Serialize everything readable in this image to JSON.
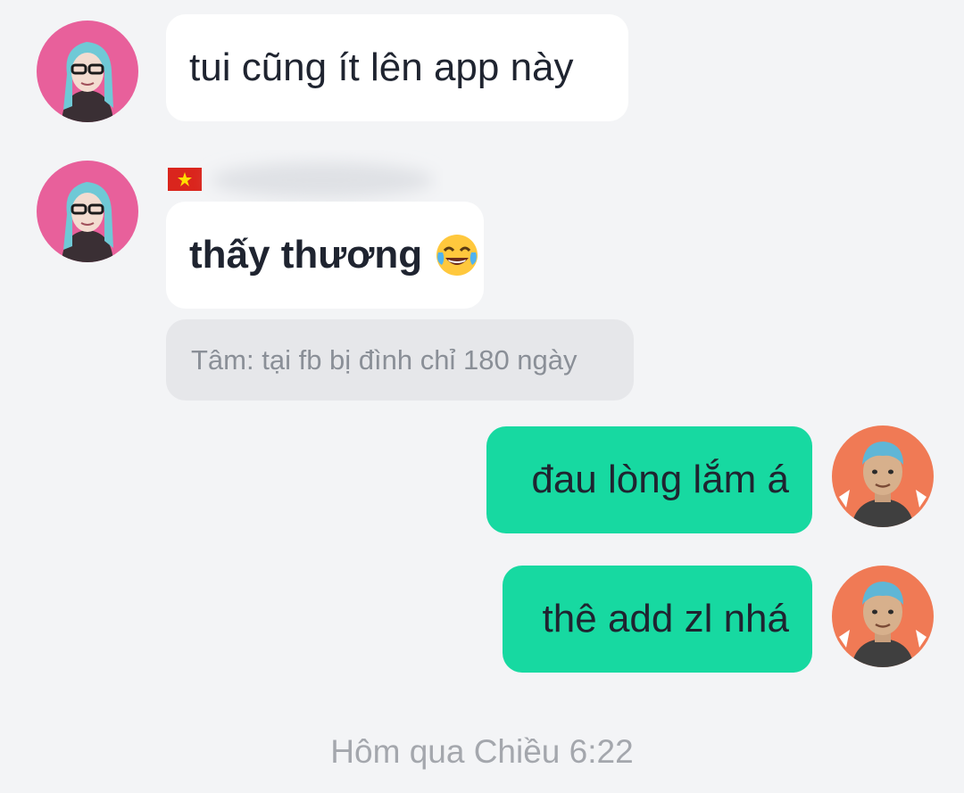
{
  "conversation": {
    "messages": [
      {
        "direction": "incoming",
        "text": "tui cũng ít lên app này"
      },
      {
        "direction": "incoming",
        "text": "thấy thương",
        "emoji": "face-with-tears-of-joy-icon"
      },
      {
        "direction": "outgoing",
        "text": "đau lòng lắm á"
      },
      {
        "direction": "outgoing",
        "text": "thê add zl nhá"
      }
    ],
    "system_note": "Tâm: tại fb bị đình chỉ 180 ngày",
    "timestamp": "Hôm qua Chiều 6:22"
  },
  "sender": {
    "flag_icon": "vietnam-flag-icon",
    "avatar_icon": "female-cartoon-avatar-icon",
    "avatar_bg": "#e8609b"
  },
  "self": {
    "avatar_icon": "male-cartoon-avatar-icon",
    "avatar_bg": "#f07a55"
  },
  "colors": {
    "background": "#f3f4f6",
    "incoming_bubble": "#ffffff",
    "outgoing_bubble": "#17d9a1",
    "system_note_bg": "#e6e7ea",
    "timestamp_text": "#a4a7ad"
  }
}
